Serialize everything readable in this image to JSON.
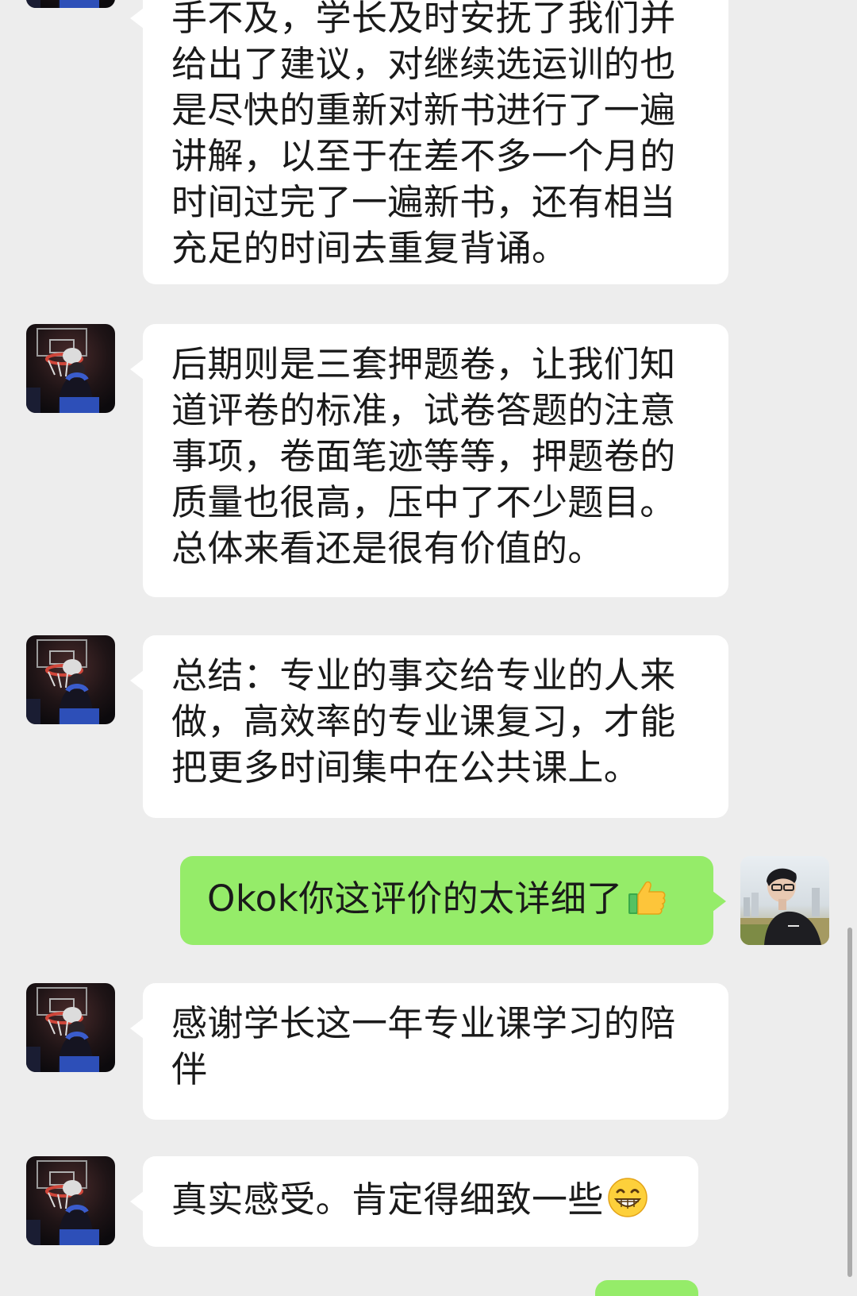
{
  "messages": [
    {
      "side": "left",
      "lines": [
        "手不及，学长及时安抚了我们并",
        "给出了建议，对继续选运训的也",
        "是尽快的重新对新书进行了一遍",
        "讲解，以至于在差不多一个月的",
        "时间过完了一遍新书，还有相当",
        "充足的时间去重复背诵。"
      ]
    },
    {
      "side": "left",
      "lines": [
        "后期则是三套押题卷，让我们知",
        "道评卷的标准，试卷答题的注意",
        "事项，卷面笔迹等等，押题卷的",
        "质量也很高，压中了不少题目。",
        "总体来看还是很有价值的。"
      ]
    },
    {
      "side": "left",
      "lines": [
        "总结：专业的事交给专业的人来",
        "做，高效率的专业课复习，才能",
        "把更多时间集中在公共课上。"
      ]
    },
    {
      "side": "right",
      "lines": [
        "Okok你这评价的太详细了"
      ],
      "emoji": "thumbs-up"
    },
    {
      "side": "left",
      "lines": [
        "感谢学长这一年专业课学习的陪",
        "伴"
      ]
    },
    {
      "side": "left",
      "lines": [
        "真实感受。肯定得细致一些"
      ],
      "emoji": "grinning-face"
    }
  ],
  "avatars": {
    "contact": "basketball-dunk-avatar",
    "self": "person-photo-avatar"
  },
  "colors": {
    "background": "#ededed",
    "incoming_bubble": "#ffffff",
    "outgoing_bubble": "#95ec69",
    "text": "#1a1a1a"
  }
}
